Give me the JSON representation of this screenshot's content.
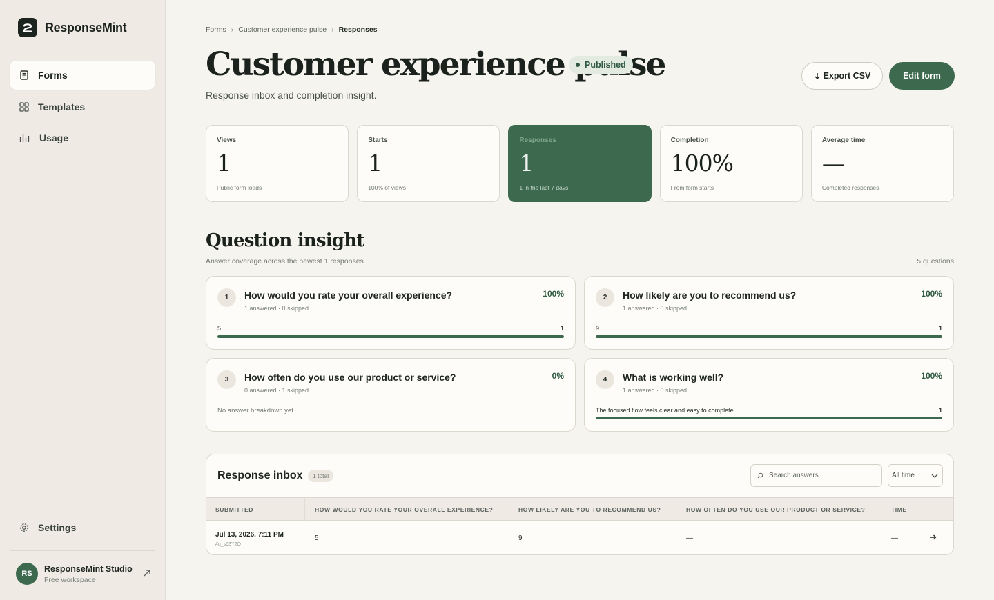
{
  "app": {
    "name": "ResponseMint"
  },
  "sidebar": {
    "items": [
      {
        "label": "Forms",
        "icon": "document-icon",
        "active": true
      },
      {
        "label": "Templates",
        "icon": "grid-icon",
        "active": false
      },
      {
        "label": "Usage",
        "icon": "bar-chart-icon",
        "active": false
      }
    ],
    "settings_label": "Settings",
    "account": {
      "initials": "RS",
      "name": "ResponseMint Studio",
      "plan": "Free workspace"
    }
  },
  "breadcrumb": [
    "Forms",
    "Customer experience pulse",
    "Responses"
  ],
  "header": {
    "title": "Customer experience pulse",
    "status": "Published",
    "subtitle": "Response inbox and completion insight.",
    "export_label": "Export CSV",
    "edit_label": "Edit form"
  },
  "stats": [
    {
      "label": "Views",
      "value": "1",
      "sub": "Public form loads",
      "highlight": false
    },
    {
      "label": "Starts",
      "value": "1",
      "sub": "100% of views",
      "highlight": false
    },
    {
      "label": "Responses",
      "value": "1",
      "sub": "1 in the last 7 days",
      "highlight": true
    },
    {
      "label": "Completion",
      "value": "100%",
      "sub": "From form starts",
      "highlight": false
    },
    {
      "label": "Average time",
      "value": "—",
      "sub": "Completed responses",
      "highlight": false
    }
  ],
  "insight": {
    "title": "Question insight",
    "subtitle": "Answer coverage across the newest 1 responses.",
    "count": "5 questions",
    "questions": [
      {
        "num": "1",
        "title": "How would you rate your overall experience?",
        "meta": "1 answered · 0 skipped",
        "pct": "100%",
        "answer": "5",
        "answer_count": "1",
        "fill": 1.0
      },
      {
        "num": "2",
        "title": "How likely are you to recommend us?",
        "meta": "1 answered · 0 skipped",
        "pct": "100%",
        "answer": "9",
        "answer_count": "1",
        "fill": 1.0
      },
      {
        "num": "3",
        "title": "How often do you use our product or service?",
        "meta": "0 answered · 1 skipped",
        "pct": "0%",
        "empty": "No answer breakdown yet."
      },
      {
        "num": "4",
        "title": "What is working well?",
        "meta": "1 answered · 0 skipped",
        "pct": "100%",
        "answer": "The focused flow feels clear and easy to complete.",
        "answer_count": "1",
        "fill": 1.0
      }
    ]
  },
  "inbox": {
    "title": "Response inbox",
    "badge": "1 total",
    "search_placeholder": "Search answers",
    "filter": "All time",
    "columns": [
      "SUBMITTED",
      "HOW WOULD YOU RATE YOUR OVERALL EXPERIENCE?",
      "HOW LIKELY ARE YOU TO RECOMMEND US?",
      "HOW OFTEN DO YOU USE OUR PRODUCT OR SERVICE?",
      "TIME"
    ],
    "rows": [
      {
        "date": "Jul 13, 2026, 7:11 PM",
        "id": "#u_s53Y2Q",
        "q1": "5",
        "q2": "9",
        "q3": "—",
        "time": "—"
      }
    ]
  }
}
